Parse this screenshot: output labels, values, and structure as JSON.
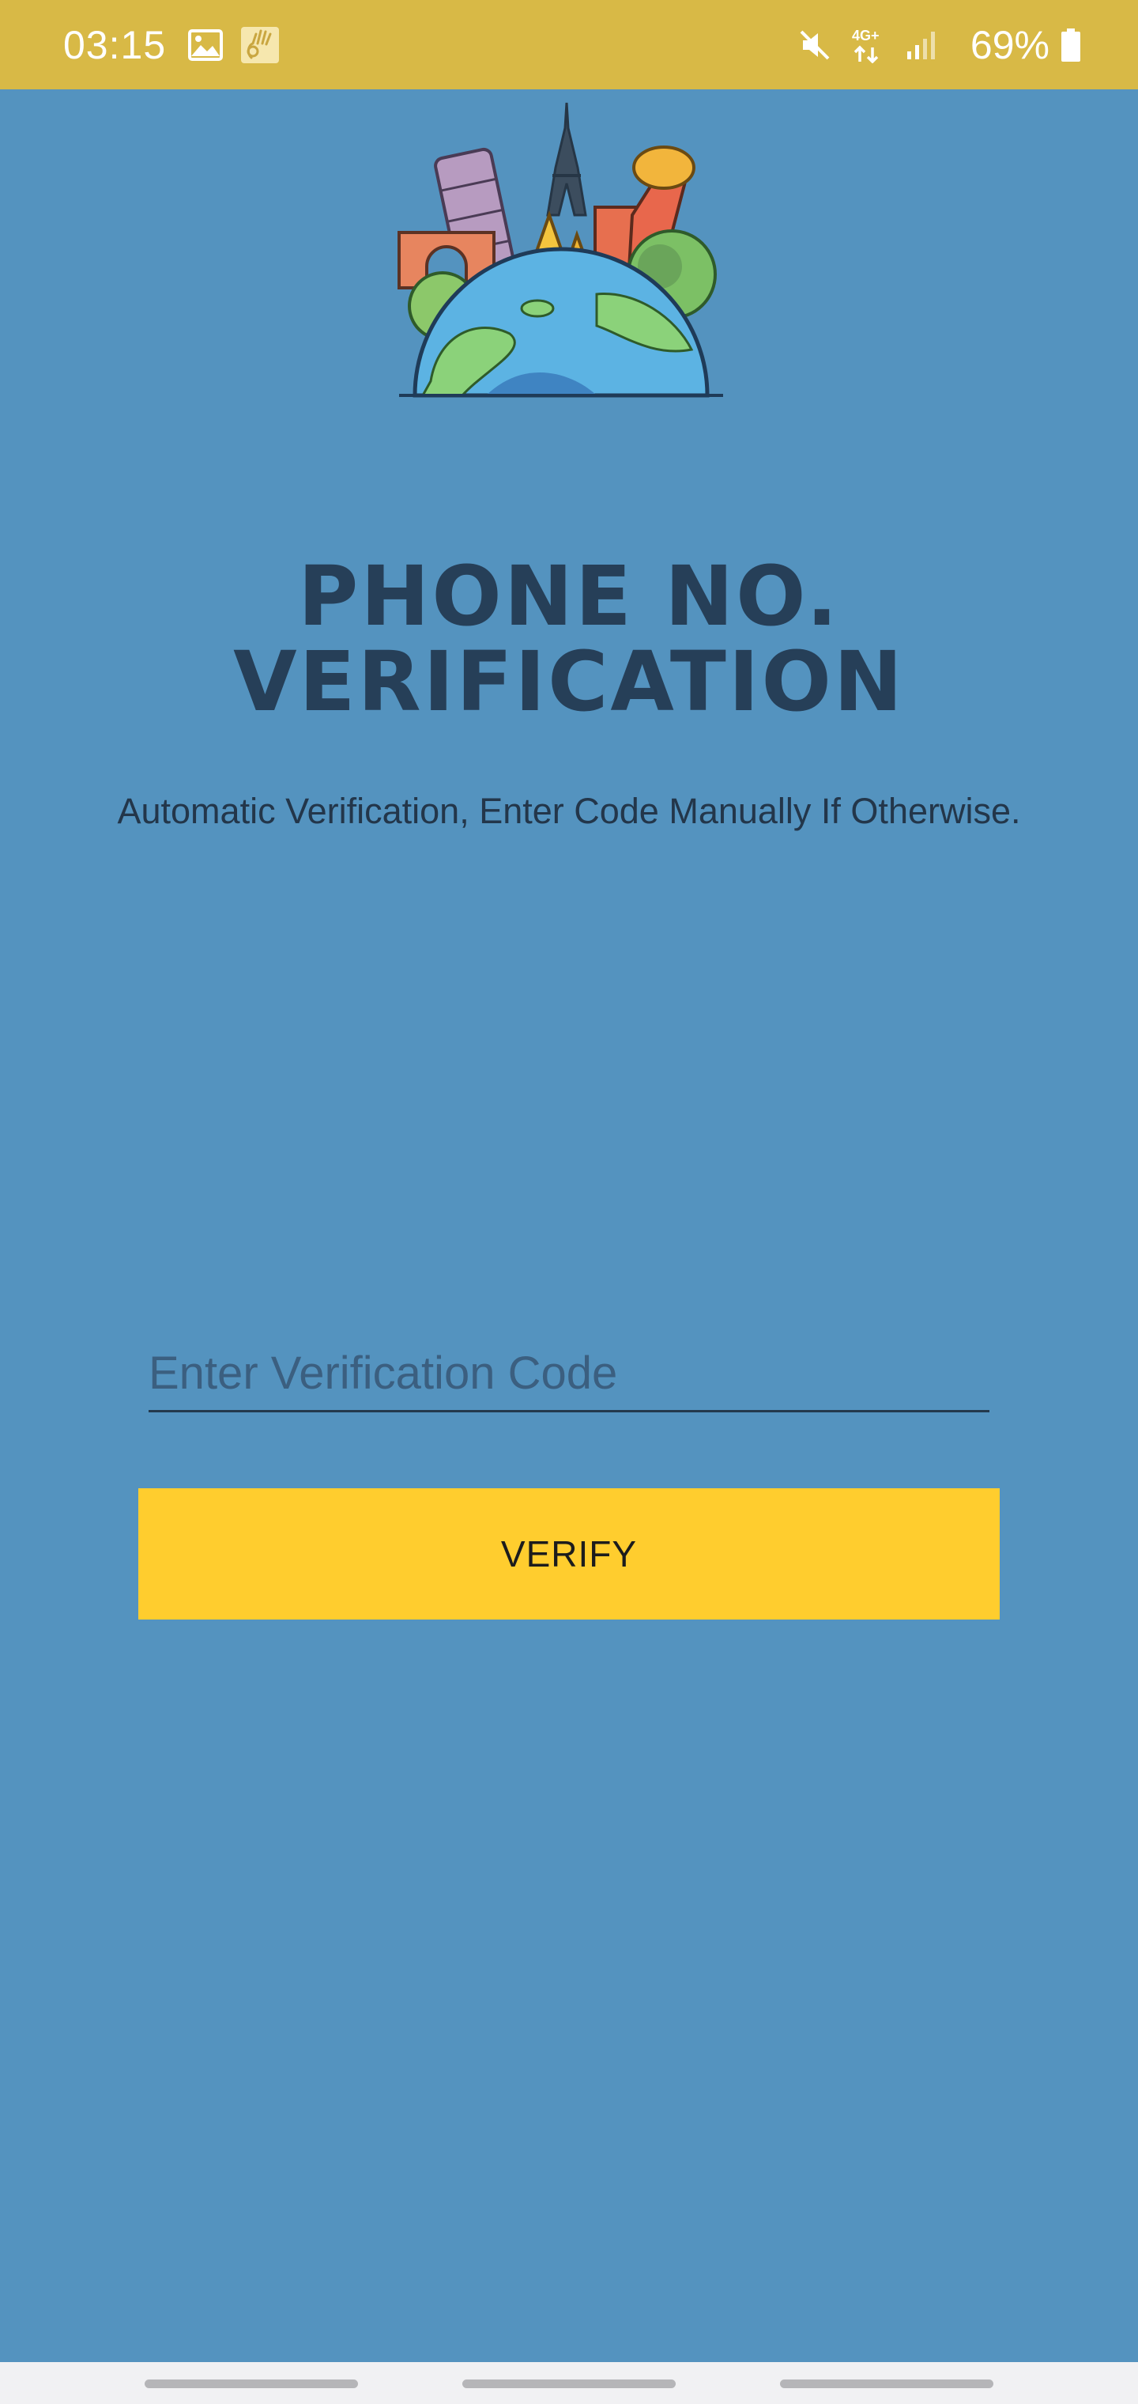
{
  "status_bar": {
    "time": "03:15",
    "left_icons": [
      "image-icon",
      "sign-language-icon"
    ],
    "right_icons": [
      "mute-icon",
      "4g-data-icon",
      "signal-icon"
    ],
    "network_label": "4G+",
    "battery_percent": "69%",
    "battery_icon": "battery-icon",
    "background": "#d8b946"
  },
  "hero": {
    "icon": "world-landmarks-illustration"
  },
  "title": {
    "line1": "PHONE NO.",
    "line2": "VERIFICATION"
  },
  "subtitle": "Automatic Verification, Enter Code Manually If Otherwise.",
  "form": {
    "code_value": "",
    "code_placeholder": "Enter Verification Code",
    "verify_label": "VERIFY"
  },
  "colors": {
    "background": "#5493bf",
    "title": "#263f58",
    "button": "#ffcd2e"
  }
}
